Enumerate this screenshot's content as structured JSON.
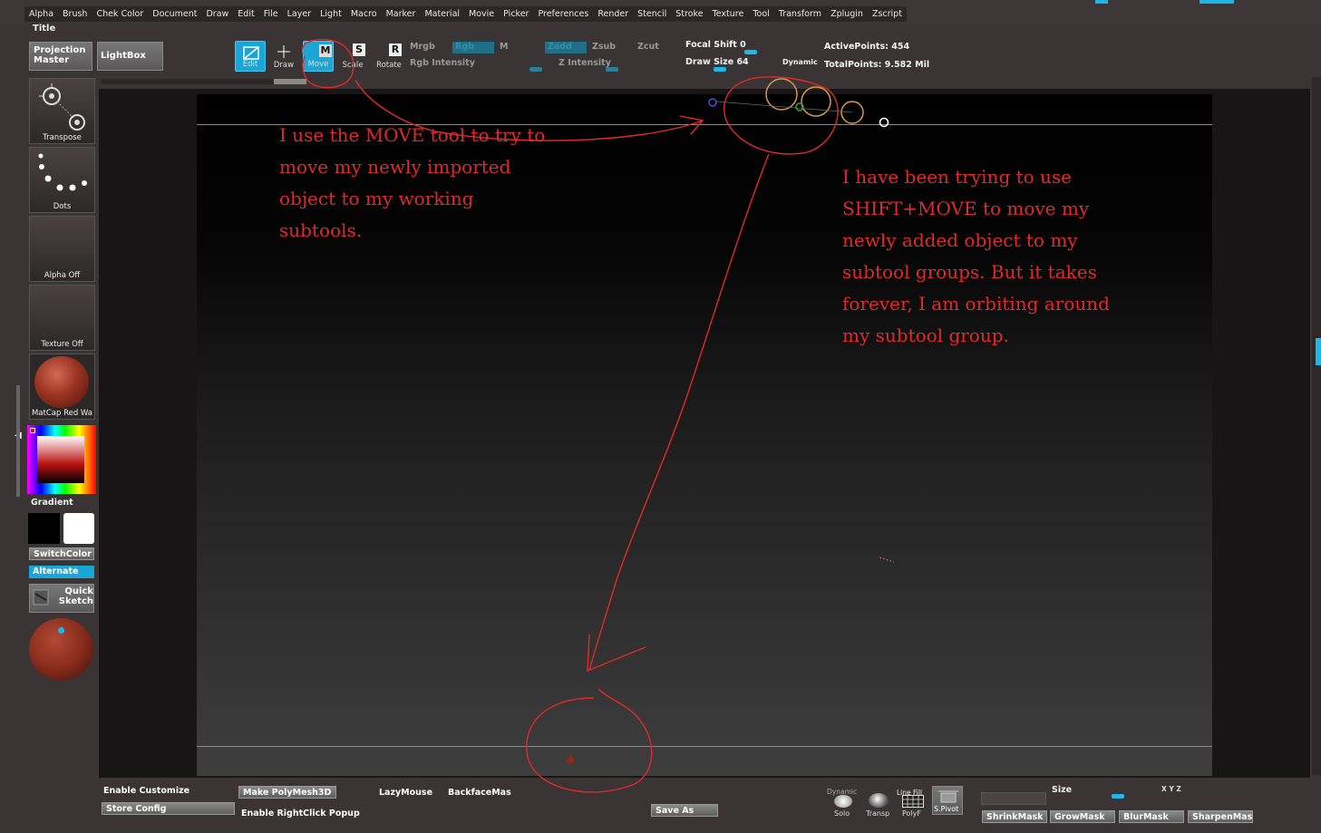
{
  "menu": [
    "Alpha",
    "Brush",
    "Chek Color",
    "Document",
    "Draw",
    "Edit",
    "File",
    "Layer",
    "Light",
    "Macro",
    "Marker",
    "Material",
    "Movie",
    "Picker",
    "Preferences",
    "Render",
    "Stencil",
    "Stroke",
    "Texture",
    "Tool",
    "Transform",
    "Zplugin",
    "Zscript"
  ],
  "title_label": "Title",
  "shelf": {
    "projection_master": "Projection Master",
    "lightbox": "LightBox",
    "tools": [
      {
        "label": "Edit",
        "icon": "edit-icon",
        "active": true
      },
      {
        "label": "Draw",
        "icon": "draw-icon",
        "active": false
      },
      {
        "label": "Move",
        "icon": "move-icon",
        "glyph": "M",
        "active": true
      },
      {
        "label": "Scale",
        "icon": "scale-icon",
        "glyph": "S",
        "active": false
      },
      {
        "label": "Rotate",
        "icon": "rotate-icon",
        "glyph": "R",
        "active": false
      }
    ],
    "mrgb": "Mrgb",
    "rgb": "Rgb",
    "m": "M",
    "rgb_intensity": "Rgb Intensity",
    "zadd": "Zadd",
    "zsub": "Zsub",
    "zcut": "Zcut",
    "z_intensity": "Z Intensity",
    "focal_shift": "Focal Shift 0",
    "draw_size": "Draw Size 64",
    "dynamic": "Dynamic",
    "active_points": "ActivePoints: 454",
    "total_points": "TotalPoints: 9.582 Mil"
  },
  "left_tray": {
    "transpose": "Transpose",
    "dots": "Dots",
    "alpha": "Alpha Off",
    "texture": "Texture Off",
    "material": "MatCap Red Wa",
    "gradient": "Gradient",
    "switch_color": "SwitchColor",
    "alternate": "Alternate",
    "quick_sketch": "Quick Sketch"
  },
  "annotations": {
    "left": [
      "I use the MOVE tool to try to",
      "move my newly imported",
      "object to my working",
      "subtools."
    ],
    "right": [
      "I have been trying to use",
      "SHIFT+MOVE to move my",
      "newly added object to my",
      "subtool groups. But it takes",
      "forever, I am orbiting around",
      "my subtool group."
    ]
  },
  "bottom": {
    "enable_customize": "Enable Customize",
    "store_config": "Store Config",
    "make_polymesh": "Make PolyMesh3D",
    "enable_rightclick": "Enable RightClick Popup",
    "lazymouse": "LazyMouse",
    "backface": "BackfaceMas",
    "save_as": "Save As",
    "solo_top": "Dynamic",
    "solo": "Solo",
    "transp": "Transp",
    "polyf_top": "Line Fill",
    "polyf": "PolyF",
    "spivot": "S.Pivot",
    "size": "Size",
    "xyz": "X Y Z",
    "shrinkmask": "ShrinkMask",
    "growmask": "GrowMask",
    "blurmask": "BlurMask",
    "sharpenmask": "SharpenMas"
  },
  "colors": {
    "accent": "#1fb7e8",
    "annotation": "#e02a2a"
  }
}
